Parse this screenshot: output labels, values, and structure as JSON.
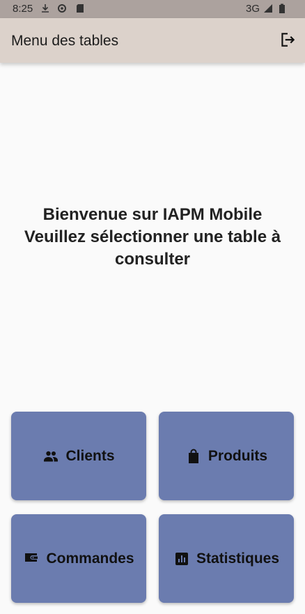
{
  "status_bar": {
    "time": "8:25",
    "network": "3G",
    "icons": [
      "download-icon",
      "settings-icon",
      "sd-card-icon",
      "signal-icon",
      "battery-icon"
    ]
  },
  "app_bar": {
    "title": "Menu des tables",
    "action_icon": "logout-icon"
  },
  "welcome": {
    "line1": "Bienvenue sur IAPM Mobile",
    "line2": "Veuillez sélectionner une table à consulter"
  },
  "tiles": [
    {
      "label": "Clients",
      "icon": "people-icon"
    },
    {
      "label": "Produits",
      "icon": "shopping-bag-icon"
    },
    {
      "label": "Commandes",
      "icon": "wallet-icon"
    },
    {
      "label": "Statistiques",
      "icon": "bar-chart-icon"
    }
  ],
  "colors": {
    "status_bar": "#aca29e",
    "app_bar": "#dcd2cb",
    "background": "#fafafa",
    "tile": "#6b7caf"
  }
}
